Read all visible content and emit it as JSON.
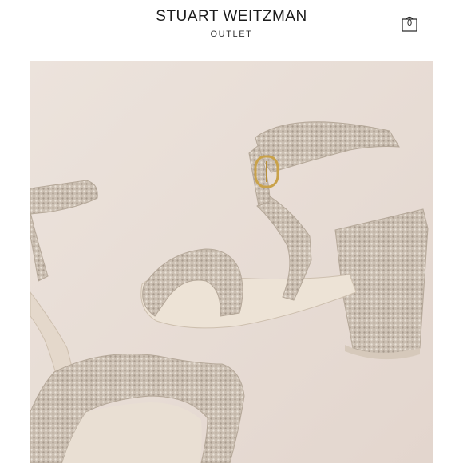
{
  "header": {
    "brand": "STUART WEITZMAN",
    "subtitle": "OUTLET",
    "bag_count": "0"
  },
  "icons": {
    "bag": "shopping-bag-icon"
  },
  "colors": {
    "hero_background": "#e8ddd6",
    "shoe_glitter": "#c9bdb0",
    "buckle_gold": "#c9a24a"
  }
}
